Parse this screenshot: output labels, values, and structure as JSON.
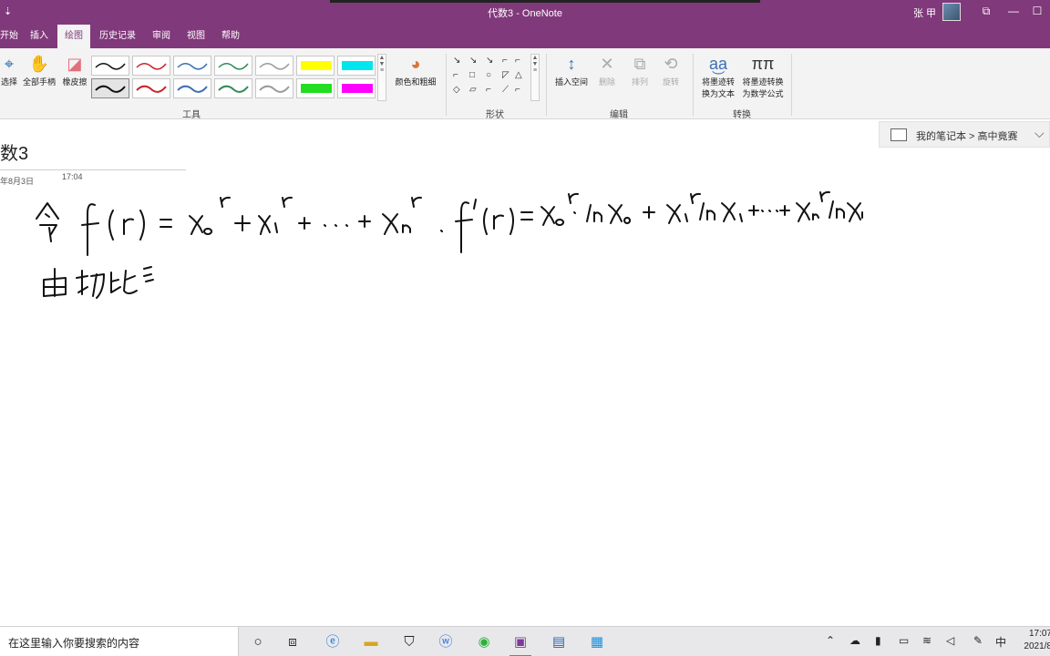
{
  "window": {
    "quick_access": "⇣",
    "title": "代数3 - OneNote",
    "user_name": "张 甲",
    "controls": [
      "⧉",
      "—",
      "☐",
      "✕"
    ]
  },
  "tabs": [
    {
      "label": "开始"
    },
    {
      "label": "插入"
    },
    {
      "label": "绘图",
      "active": true
    },
    {
      "label": "历史记录"
    },
    {
      "label": "审阅"
    },
    {
      "label": "视图"
    },
    {
      "label": "帮助"
    }
  ],
  "ribbon": {
    "tools": {
      "select_label": "选择",
      "hand_label": "全部手柄",
      "eraser_label": "橡皮擦",
      "color_width_label": "颜色和粗细",
      "group_label": "工具"
    },
    "pens": {
      "colors": [
        "#111111",
        "#c8232c",
        "#3b6fb6",
        "#2e8b57",
        "#9a9a9a",
        "#ffff00",
        "#00e5ee",
        "#111111",
        "#c8232c",
        "#3b6fb6",
        "#2e8b57",
        "#9a9a9a",
        "#22dd22",
        "#ff00ff"
      ],
      "selected_index": 7
    },
    "shapes": {
      "group_label": "形状",
      "glyphs": [
        "↘",
        "↘",
        "↘",
        "⌐",
        "⌐",
        "⌐",
        "□",
        "○",
        "◸",
        "△",
        "◇",
        "▱",
        "⌐",
        "⟋",
        "⌐",
        "╱"
      ]
    },
    "edit": {
      "insert_space_label": "插入空间",
      "delete_label": "删除",
      "arrange_label": "排列",
      "rotate_label": "旋转",
      "group_label": "编辑"
    },
    "convert": {
      "ink_to_text_label_1": "将墨迹转",
      "ink_to_text_label_2": "换为文本",
      "ink_to_math_label_1": "将墨迹转换",
      "ink_to_math_label_2": "为数学公式",
      "group_label": "转换"
    }
  },
  "page": {
    "title": "数3",
    "date": "年8月3日",
    "time": "17:04",
    "breadcrumb": "我的笔记本 > 高中竟赛"
  },
  "taskbar": {
    "search_placeholder": "在这里输入你要搜索的内容",
    "ime": "中",
    "time": "17:07",
    "date": "2021/8"
  }
}
